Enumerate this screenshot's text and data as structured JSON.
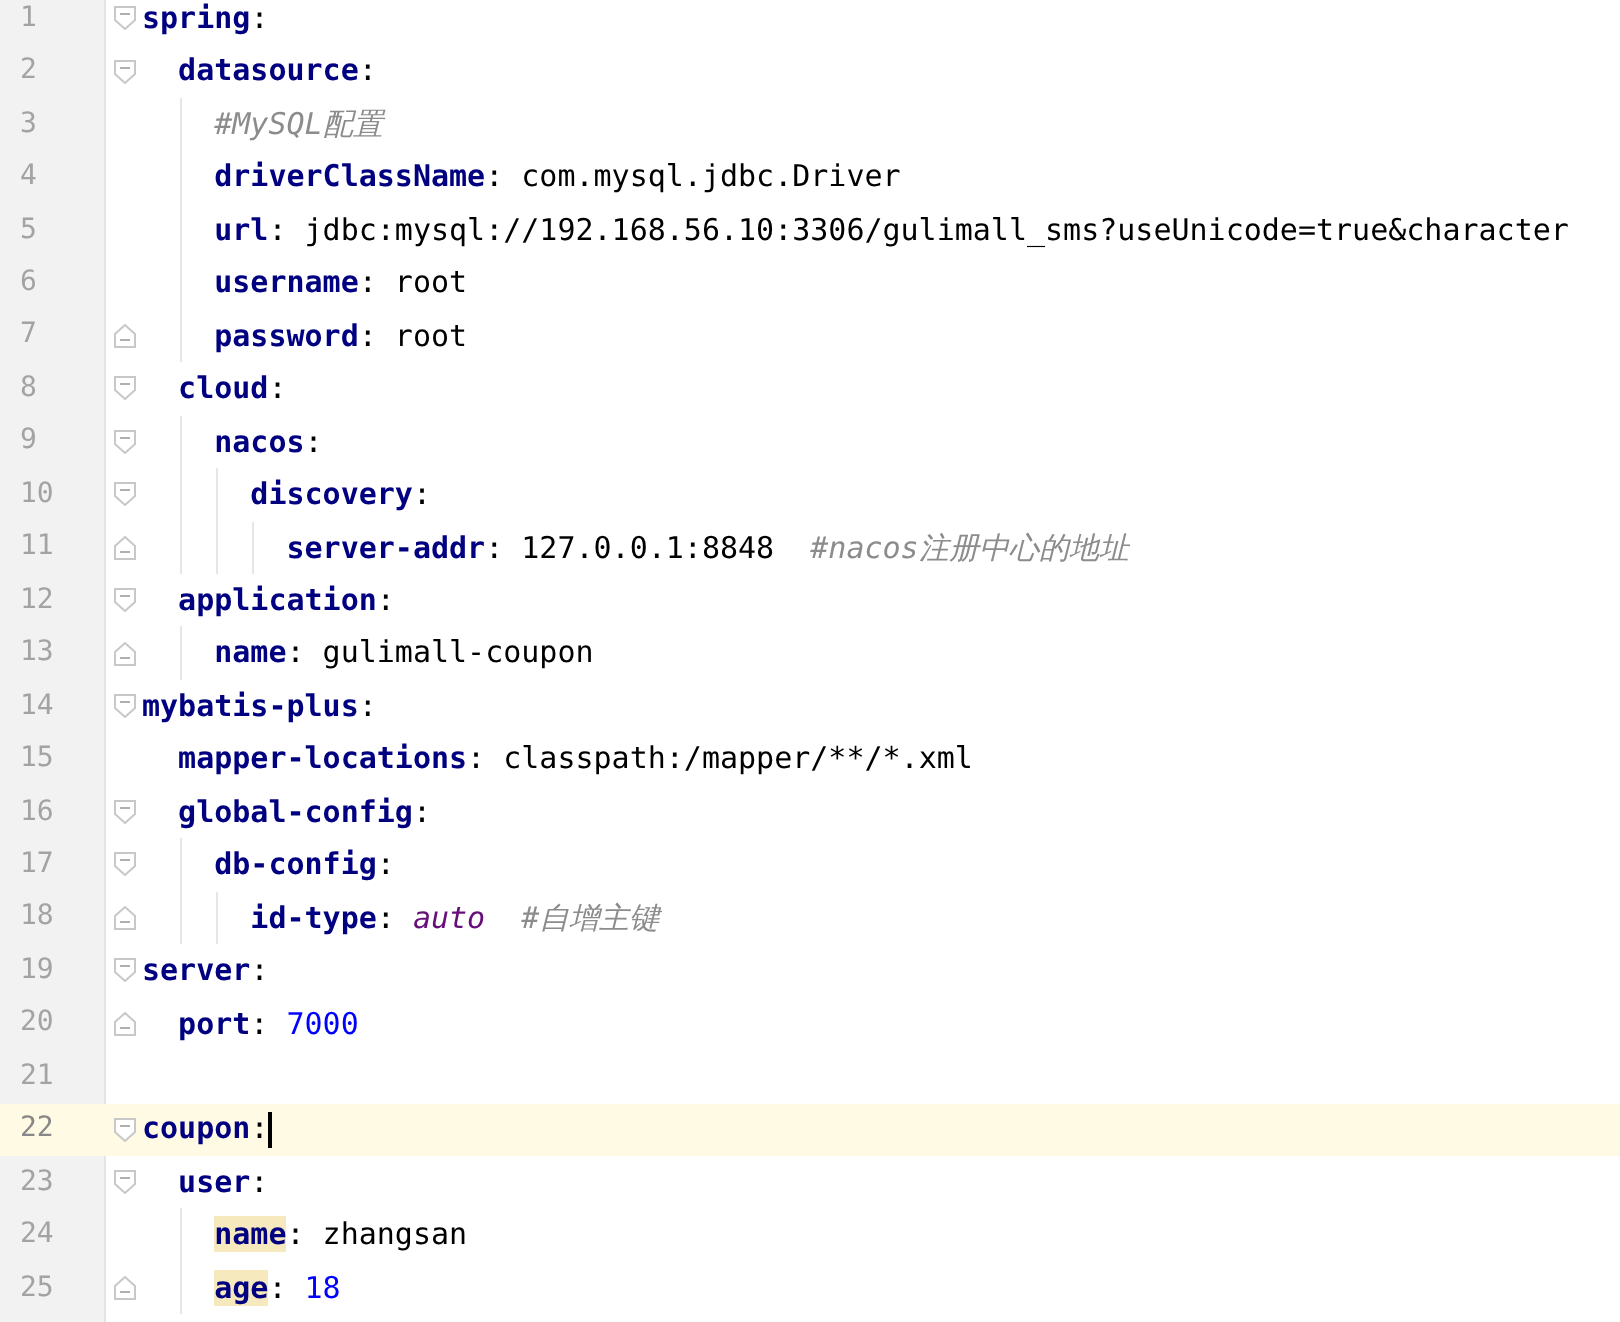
{
  "editor": {
    "lines": [
      {
        "number": "1",
        "fold_start": true,
        "fold_end": false,
        "current": false,
        "tokens": [
          {
            "kind": "key",
            "text": "spring",
            "highlighted": false
          },
          {
            "kind": "punct",
            "text": ":"
          }
        ],
        "children": [
          {
            "number": "2",
            "fold_start": true,
            "fold_end": false,
            "current": false,
            "tokens": [
              {
                "kind": "key",
                "text": "datasource",
                "highlighted": false
              },
              {
                "kind": "punct",
                "text": ":"
              }
            ],
            "children": [
              {
                "number": "3",
                "fold_start": false,
                "fold_end": false,
                "current": false,
                "tokens": [
                  {
                    "kind": "comment",
                    "text": "#MySQL配置"
                  }
                ]
              },
              {
                "number": "4",
                "fold_start": false,
                "fold_end": false,
                "current": false,
                "tokens": [
                  {
                    "kind": "key",
                    "text": "driverClassName",
                    "highlighted": false
                  },
                  {
                    "kind": "punct",
                    "text": ": "
                  },
                  {
                    "kind": "value",
                    "text": "com.mysql.jdbc.Driver"
                  }
                ]
              },
              {
                "number": "5",
                "fold_start": false,
                "fold_end": false,
                "current": false,
                "tokens": [
                  {
                    "kind": "key",
                    "text": "url",
                    "highlighted": false
                  },
                  {
                    "kind": "punct",
                    "text": ": "
                  },
                  {
                    "kind": "value",
                    "text": "jdbc:mysql://192.168.56.10:3306/gulimall_sms?useUnicode=true&character"
                  }
                ]
              },
              {
                "number": "6",
                "fold_start": false,
                "fold_end": false,
                "current": false,
                "tokens": [
                  {
                    "kind": "key",
                    "text": "username",
                    "highlighted": false
                  },
                  {
                    "kind": "punct",
                    "text": ": "
                  },
                  {
                    "kind": "value",
                    "text": "root"
                  }
                ]
              },
              {
                "number": "7",
                "fold_start": false,
                "fold_end": true,
                "current": false,
                "tokens": [
                  {
                    "kind": "key",
                    "text": "password",
                    "highlighted": false
                  },
                  {
                    "kind": "punct",
                    "text": ": "
                  },
                  {
                    "kind": "value",
                    "text": "root"
                  }
                ]
              }
            ]
          },
          {
            "number": "8",
            "fold_start": true,
            "fold_end": false,
            "current": false,
            "tokens": [
              {
                "kind": "key",
                "text": "cloud",
                "highlighted": false
              },
              {
                "kind": "punct",
                "text": ":"
              }
            ],
            "children": [
              {
                "number": "9",
                "fold_start": true,
                "fold_end": false,
                "current": false,
                "tokens": [
                  {
                    "kind": "key",
                    "text": "nacos",
                    "highlighted": false
                  },
                  {
                    "kind": "punct",
                    "text": ":"
                  }
                ],
                "children": [
                  {
                    "number": "10",
                    "fold_start": true,
                    "fold_end": false,
                    "current": false,
                    "tokens": [
                      {
                        "kind": "key",
                        "text": "discovery",
                        "highlighted": false
                      },
                      {
                        "kind": "punct",
                        "text": ":"
                      }
                    ],
                    "children": [
                      {
                        "number": "11",
                        "fold_start": false,
                        "fold_end": true,
                        "current": false,
                        "tokens": [
                          {
                            "kind": "key",
                            "text": "server-addr",
                            "highlighted": false
                          },
                          {
                            "kind": "punct",
                            "text": ": "
                          },
                          {
                            "kind": "value",
                            "text": "127.0.0.1:8848  "
                          },
                          {
                            "kind": "comment",
                            "text": "#nacos注册中心的地址"
                          }
                        ]
                      }
                    ]
                  }
                ]
              }
            ]
          },
          {
            "number": "12",
            "fold_start": true,
            "fold_end": false,
            "current": false,
            "tokens": [
              {
                "kind": "key",
                "text": "application",
                "highlighted": false
              },
              {
                "kind": "punct",
                "text": ":"
              }
            ],
            "children": [
              {
                "number": "13",
                "fold_start": false,
                "fold_end": true,
                "current": false,
                "tokens": [
                  {
                    "kind": "key",
                    "text": "name",
                    "highlighted": false
                  },
                  {
                    "kind": "punct",
                    "text": ": "
                  },
                  {
                    "kind": "value",
                    "text": "gulimall-coupon"
                  }
                ]
              }
            ]
          }
        ]
      },
      {
        "number": "14",
        "fold_start": true,
        "fold_end": false,
        "current": false,
        "tokens": [
          {
            "kind": "key",
            "text": "mybatis-plus",
            "highlighted": false
          },
          {
            "kind": "punct",
            "text": ":"
          }
        ],
        "children": [
          {
            "number": "15",
            "fold_start": false,
            "fold_end": false,
            "current": false,
            "tokens": [
              {
                "kind": "key",
                "text": "mapper-locations",
                "highlighted": false
              },
              {
                "kind": "punct",
                "text": ": "
              },
              {
                "kind": "value",
                "text": "classpath:/mapper/**/*.xml"
              }
            ]
          },
          {
            "number": "16",
            "fold_start": true,
            "fold_end": false,
            "current": false,
            "tokens": [
              {
                "kind": "key",
                "text": "global-config",
                "highlighted": false
              },
              {
                "kind": "punct",
                "text": ":"
              }
            ],
            "children": [
              {
                "number": "17",
                "fold_start": true,
                "fold_end": false,
                "current": false,
                "tokens": [
                  {
                    "kind": "key",
                    "text": "db-config",
                    "highlighted": false
                  },
                  {
                    "kind": "punct",
                    "text": ":"
                  }
                ],
                "children": [
                  {
                    "number": "18",
                    "fold_start": false,
                    "fold_end": true,
                    "current": false,
                    "tokens": [
                      {
                        "kind": "key",
                        "text": "id-type",
                        "highlighted": false
                      },
                      {
                        "kind": "punct",
                        "text": ": "
                      },
                      {
                        "kind": "constant",
                        "text": "auto"
                      },
                      {
                        "kind": "comment",
                        "text": "  #自增主键"
                      }
                    ]
                  }
                ]
              }
            ]
          }
        ]
      },
      {
        "number": "19",
        "fold_start": true,
        "fold_end": false,
        "current": false,
        "tokens": [
          {
            "kind": "key",
            "text": "server",
            "highlighted": false
          },
          {
            "kind": "punct",
            "text": ":"
          }
        ],
        "children": [
          {
            "number": "20",
            "fold_start": false,
            "fold_end": true,
            "current": false,
            "tokens": [
              {
                "kind": "key",
                "text": "port",
                "highlighted": false
              },
              {
                "kind": "punct",
                "text": ": "
              },
              {
                "kind": "number",
                "text": "7000"
              }
            ]
          }
        ]
      },
      {
        "number": "21",
        "fold_start": false,
        "fold_end": false,
        "current": false
      },
      {
        "number": "22",
        "fold_start": true,
        "fold_end": false,
        "current": true,
        "tokens": [
          {
            "kind": "key",
            "text": "coupon",
            "highlighted": false
          },
          {
            "kind": "punct",
            "text": ":"
          }
        ],
        "children": [
          {
            "number": "23",
            "fold_start": true,
            "fold_end": false,
            "current": false,
            "tokens": [
              {
                "kind": "key",
                "text": "user",
                "highlighted": false
              },
              {
                "kind": "punct",
                "text": ":"
              }
            ],
            "children": [
              {
                "number": "24",
                "fold_start": false,
                "fold_end": false,
                "current": false,
                "tokens": [
                  {
                    "kind": "key",
                    "text": "name",
                    "highlighted": true
                  },
                  {
                    "kind": "punct",
                    "text": ": "
                  },
                  {
                    "kind": "value",
                    "text": "zhangsan"
                  }
                ]
              },
              {
                "number": "25",
                "fold_start": false,
                "fold_end": true,
                "current": false,
                "tokens": [
                  {
                    "kind": "key",
                    "text": "age",
                    "highlighted": true
                  },
                  {
                    "kind": "punct",
                    "text": ": "
                  },
                  {
                    "kind": "number",
                    "text": "18"
                  }
                ]
              }
            ]
          }
        ]
      }
    ]
  }
}
